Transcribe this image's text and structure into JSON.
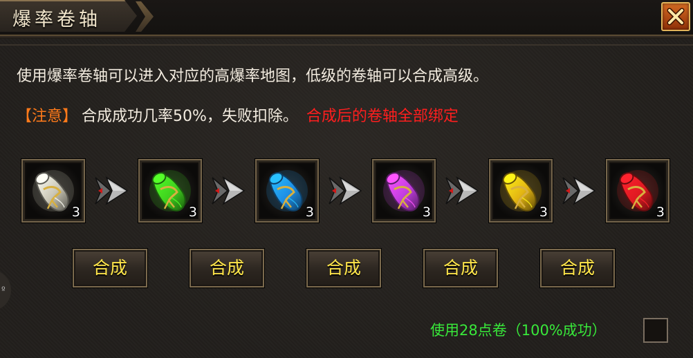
{
  "title": "爆率卷轴",
  "description": "使用爆率卷轴可以进入对应的高爆率地图，低级的卷轴可以合成高级。",
  "notice": {
    "tag": "【注意】",
    "text": "合成成功几率50%，失败扣除。",
    "warning": "合成后的卷轴全部绑定"
  },
  "scrolls": [
    {
      "name": "white-scroll",
      "color": "#c9c6b6",
      "qty": "3"
    },
    {
      "name": "green-scroll",
      "color": "#3fd21e",
      "qty": "3"
    },
    {
      "name": "blue-scroll",
      "color": "#1e8fe6",
      "qty": "3"
    },
    {
      "name": "purple-scroll",
      "color": "#c23ee0",
      "qty": "3"
    },
    {
      "name": "gold-scroll",
      "color": "#e3b512",
      "qty": "3"
    },
    {
      "name": "red-scroll",
      "color": "#e01a22",
      "qty": "3"
    }
  ],
  "buttons": [
    "合成",
    "合成",
    "合成",
    "合成",
    "合成"
  ],
  "option": {
    "label": "使用28点卷（100%成功）",
    "checked": false
  },
  "side_tab_glyph": "º",
  "colors": {
    "title": "#f2e6cc",
    "text": "#f3ece0",
    "notice_tag": "#ff7a1a",
    "warning": "#ff1e1e",
    "button_text": "#ffe64a",
    "option_text": "#38e83a",
    "close_button": "#c2581a"
  }
}
